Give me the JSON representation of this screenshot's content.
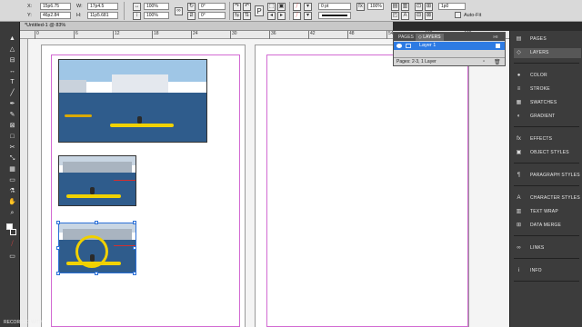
{
  "control_bar": {
    "x_label": "X:",
    "x_value": "15p6.75",
    "y_label": "Y:",
    "y_value": "46p2.84",
    "w_label": "W:",
    "w_value": "17p4.5",
    "h_label": "H:",
    "h_value": "11p5.681",
    "scale_x": "100%",
    "scale_y": "100%",
    "rotate": "0°",
    "shear": "0°",
    "stroke_weight": "0 pt",
    "opacity": "100%",
    "size_value": "1p0",
    "auto_fit_label": "Auto-Fit",
    "p_icon": "P",
    "a_icon": "A"
  },
  "document": {
    "tab_title": "*Untitled-1 @ 83%",
    "ruler_numbers": [
      "0",
      "6",
      "12",
      "18",
      "24",
      "30",
      "36",
      "42",
      "48",
      "54",
      "60",
      "66"
    ]
  },
  "layers_panel": {
    "tabs": [
      "PAGES",
      "◇ LAYERS"
    ],
    "active_tab": 1,
    "layer_name": "Layer 1",
    "footer": "Pages: 2-3, 1 Layer"
  },
  "dock": {
    "groups": [
      [
        {
          "label": "PAGES",
          "icon": "pages-icon"
        },
        {
          "label": "LAYERS",
          "icon": "layers-icon",
          "active": true
        }
      ],
      [
        {
          "label": "COLOR",
          "icon": "color-icon"
        },
        {
          "label": "STROKE",
          "icon": "stroke-icon"
        },
        {
          "label": "SWATCHES",
          "icon": "swatches-icon"
        },
        {
          "label": "GRADIENT",
          "icon": "gradient-icon"
        }
      ],
      [
        {
          "label": "EFFECTS",
          "icon": "effects-icon"
        },
        {
          "label": "OBJECT STYLES",
          "icon": "object-styles-icon"
        }
      ],
      [
        {
          "label": "PARAGRAPH STYLES",
          "icon": "paragraph-styles-icon"
        }
      ],
      [
        {
          "label": "CHARACTER STYLES",
          "icon": "character-styles-icon"
        },
        {
          "label": "TEXT WRAP",
          "icon": "text-wrap-icon"
        },
        {
          "label": "DATA MERGE",
          "icon": "data-merge-icon"
        }
      ],
      [
        {
          "label": "LINKS",
          "icon": "links-icon"
        }
      ],
      [
        {
          "label": "INFO",
          "icon": "info-icon"
        }
      ]
    ]
  },
  "watermark": "RECORDED WITH",
  "colors": {
    "accent": "#2e7be3",
    "margin_guide": "#d26ad2",
    "kayak": "#f1d200",
    "highlight_ring": "#f0d000"
  }
}
